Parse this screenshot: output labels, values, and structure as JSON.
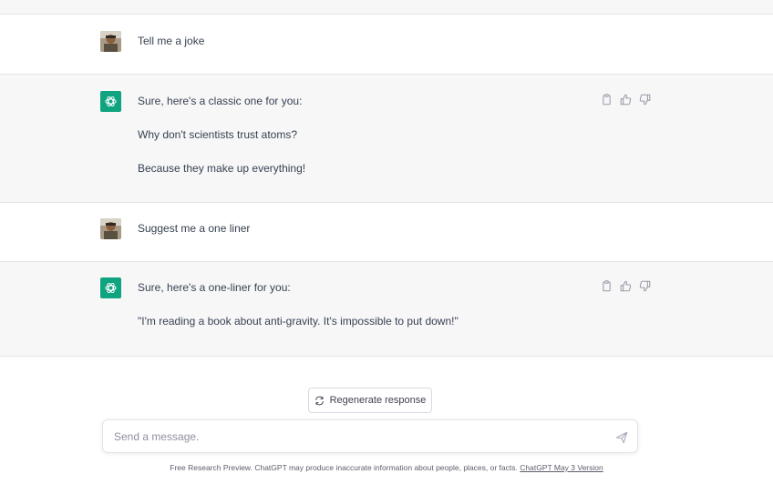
{
  "conversation": {
    "messages": [
      {
        "role": "user",
        "text": "Tell me a joke"
      },
      {
        "role": "assistant",
        "lines": [
          "Sure, here's a classic one for you:",
          "Why don't scientists trust atoms?",
          "Because they make up everything!"
        ]
      },
      {
        "role": "user",
        "text": "Suggest me a one liner"
      },
      {
        "role": "assistant",
        "lines": [
          "Sure, here's a one-liner for you:",
          "\"I'm reading a book about anti-gravity. It's impossible to put down!\""
        ]
      }
    ],
    "action_icons": [
      "clipboard-icon",
      "thumbs-up-icon",
      "thumbs-down-icon"
    ]
  },
  "regenerate": {
    "label": "Regenerate response",
    "icon": "refresh-icon"
  },
  "composer": {
    "placeholder": "Send a message.",
    "send_icon": "send-icon"
  },
  "footer": {
    "text": "Free Research Preview. ChatGPT may produce inaccurate information about people, places, or facts.",
    "link": "ChatGPT May 3 Version"
  },
  "colors": {
    "accent": "#10a37f",
    "assistant_bg": "#f7f7f8",
    "text": "#374151"
  }
}
